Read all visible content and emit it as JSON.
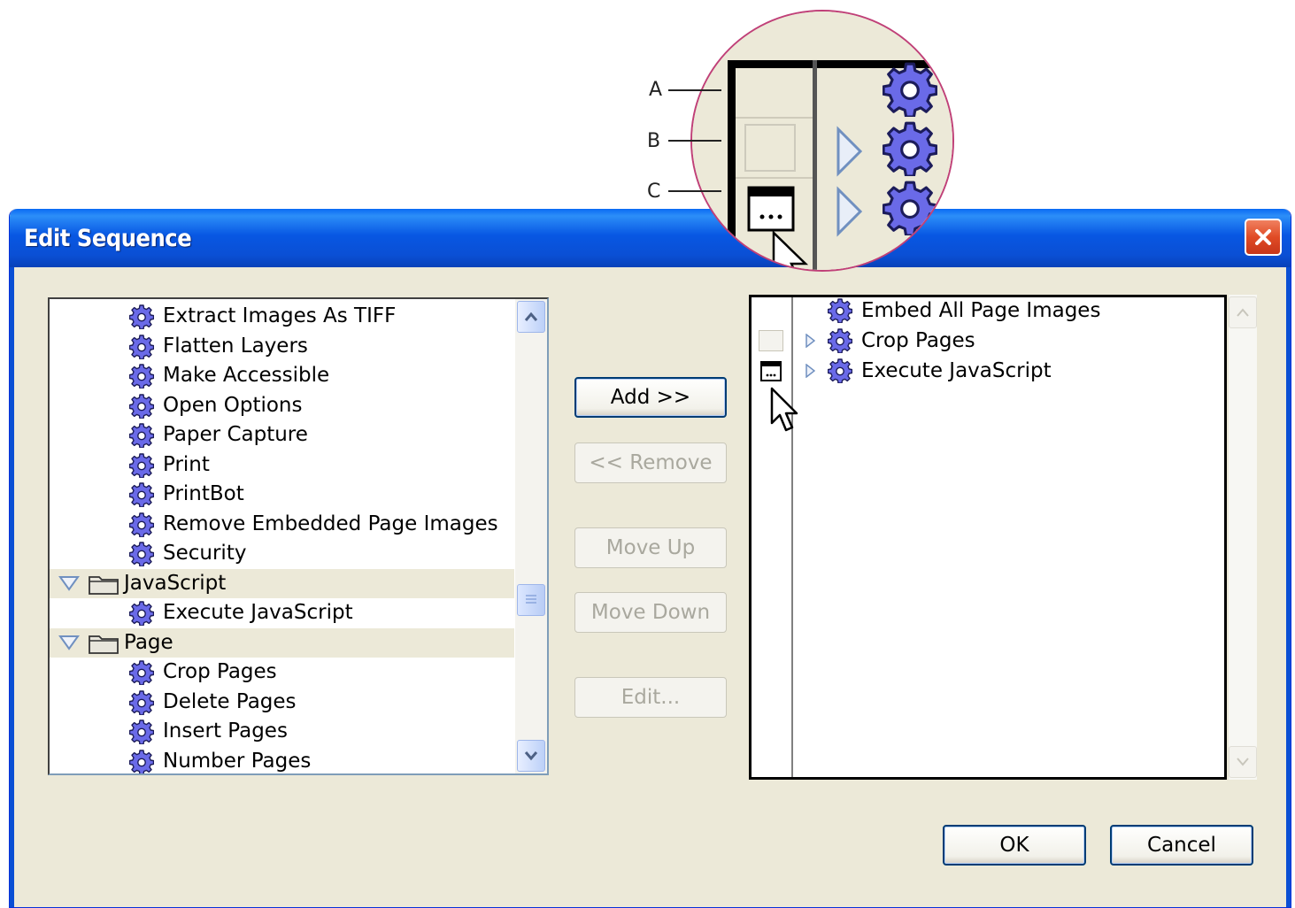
{
  "dialog": {
    "title": "Edit Sequence",
    "close_label": "×"
  },
  "left_list": {
    "items": [
      {
        "type": "command",
        "label": "Extract Images As TIFF"
      },
      {
        "type": "command",
        "label": "Flatten Layers"
      },
      {
        "type": "command",
        "label": "Make Accessible"
      },
      {
        "type": "command",
        "label": "Open Options"
      },
      {
        "type": "command",
        "label": "Paper Capture"
      },
      {
        "type": "command",
        "label": "Print"
      },
      {
        "type": "command",
        "label": "PrintBot"
      },
      {
        "type": "command",
        "label": "Remove Embedded Page Images"
      },
      {
        "type": "command",
        "label": "Security"
      },
      {
        "type": "folder",
        "label": "JavaScript"
      },
      {
        "type": "command",
        "label": "Execute JavaScript"
      },
      {
        "type": "folder",
        "label": "Page"
      },
      {
        "type": "command",
        "label": "Crop Pages"
      },
      {
        "type": "command",
        "label": "Delete Pages"
      },
      {
        "type": "command",
        "label": "Insert Pages"
      },
      {
        "type": "command",
        "label": "Number Pages"
      }
    ]
  },
  "buttons": {
    "add": "Add >>",
    "remove": "<< Remove",
    "move_up": "Move Up",
    "move_down": "Move Down",
    "edit": "Edit...",
    "ok": "OK",
    "cancel": "Cancel"
  },
  "sequence_list": {
    "items": [
      {
        "label": "Embed All Page Images",
        "dialog_toggle": "none",
        "expandable": false
      },
      {
        "label": "Crop Pages",
        "dialog_toggle": "empty",
        "expandable": true
      },
      {
        "label": "Execute JavaScript",
        "dialog_toggle": "dialog",
        "expandable": true
      }
    ]
  },
  "callout": {
    "labels": [
      "A",
      "B",
      "C"
    ]
  },
  "colors": {
    "accent_titlebar": "#0a4fd4",
    "gear": "#6a6ae8",
    "dialog_bg": "#ece9d8",
    "close": "#e04b25",
    "callout_border": "#c04078"
  }
}
